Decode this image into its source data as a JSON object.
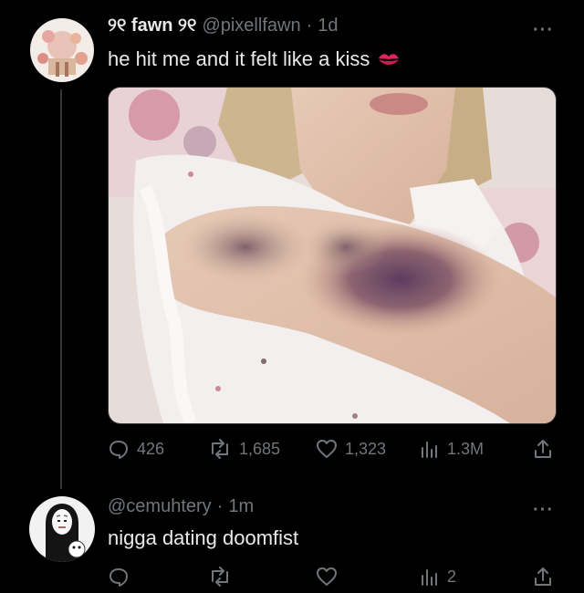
{
  "tweet": {
    "display_name": "୨୧ fawn ୨୧",
    "handle": "@pixellfawn",
    "time": "1d",
    "text": "he hit me and it felt like a kiss",
    "emoji": "💋",
    "metrics": {
      "replies": "426",
      "reposts": "1,685",
      "likes": "1,323",
      "views": "1.3M"
    }
  },
  "reply": {
    "handle": "@cemuhtery",
    "time": "1m",
    "text": "nigga dating doomfist",
    "metrics": {
      "views": "2"
    }
  },
  "colors": {
    "background": "#000000",
    "text_primary": "#e7e9ea",
    "text_secondary": "#71767b",
    "emoji_red": "#e0245e"
  },
  "icons": [
    "avatar",
    "more-icon",
    "reply-icon",
    "repost-icon",
    "like-icon",
    "views-icon",
    "share-icon"
  ]
}
